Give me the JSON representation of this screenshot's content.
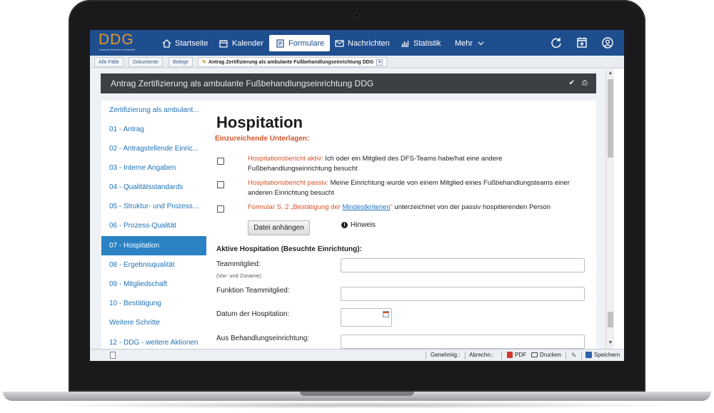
{
  "app": {
    "logo_text": "DDG",
    "logo_subtitle": "Deutsche Diabetes Gesellschaft"
  },
  "nav": {
    "items": [
      {
        "label": "Startseite",
        "icon": "home-icon"
      },
      {
        "label": "Kalender",
        "icon": "calendar-icon"
      },
      {
        "label": "Formulare",
        "icon": "document-icon",
        "active": true
      },
      {
        "label": "Nachrichten",
        "icon": "mail-icon"
      },
      {
        "label": "Statistik",
        "icon": "bar-chart-icon"
      },
      {
        "label": "Mehr",
        "icon": "chevron-down-icon"
      }
    ],
    "right_icons": [
      "refresh-icon",
      "calendar-add-icon",
      "user-icon"
    ]
  },
  "tabs": [
    {
      "label": "Alle Fälle"
    },
    {
      "label": "Dokumente"
    },
    {
      "label": "Belege"
    },
    {
      "label": "Antrag Zertifizierung als ambulante Fußbehandlungseinrichtung DDG",
      "active": true
    }
  ],
  "form_title": "Antrag Zertifizierung als ambulante Fußbehandlungseinrichtung DDG",
  "sidebar": {
    "items": [
      {
        "label": "Zertifizierung als ambulant..."
      },
      {
        "label": "01 - Antrag"
      },
      {
        "label": "02 - Antragstellende Einric..."
      },
      {
        "label": "03 - Interne Angaben"
      },
      {
        "label": "04 - Qualitätsstandards"
      },
      {
        "label": "05 - Struktur- und Prozess..."
      },
      {
        "label": "06 - Prozess-Qualität"
      },
      {
        "label": "07 - Hospitation",
        "active": true
      },
      {
        "label": "08 - Ergebnisqualität"
      },
      {
        "label": "09 - Mitgliedschaft"
      },
      {
        "label": "10 - Bestätigung"
      },
      {
        "label": "Weitere Schritte"
      },
      {
        "label": "12 - DDG - weitere Aktionen"
      }
    ]
  },
  "main": {
    "heading": "Hospitation",
    "subheading": "Einzureichende Unterlagen:",
    "requirements": [
      {
        "highlight": "Hospitationsbericht aktiv:",
        "text": " Ich oder ein Mitglied des DFS-Teams habe/hat eine andere Fußbehandlungseinrichtung besucht"
      },
      {
        "highlight": "Hospitationsbericht passiv:",
        "text": " Meine Einrichtung wurde von einem Mitglied eines Fußbehandlungsteams einer anderen Einrichtung besucht"
      },
      {
        "highlight": "Formular S. 2 „Bestätigung der ",
        "link": "Mindestkriterien",
        "highlight_end": "“",
        "text": " unterzeichnet von der passiv hospitierenden Person"
      }
    ],
    "attach_button": "Datei anhängen",
    "hint": "Hinweis",
    "section_heading": "Aktive Hospitation (Besuchte Einrichtung):",
    "fields": [
      {
        "label": "Teammitglied:",
        "sublabel": "(Vor- und Zuname)",
        "value": ""
      },
      {
        "label": "Funktion Teammitglied:",
        "value": ""
      },
      {
        "label": "Datum der Hospitation:",
        "value": ""
      },
      {
        "label": "Aus Behandlungseinrichtung:",
        "value": ""
      }
    ]
  },
  "statusbar": {
    "genehmig": "Genehmig.:",
    "abrechn": "Abrechn.:",
    "pdf": "PDF",
    "drucken": "Drucken",
    "speichern": "Speichern"
  },
  "colors": {
    "nav_bg": "#1f4e8f",
    "accent_orange": "#d5532a",
    "link_blue": "#1f72b8",
    "active_sidebar": "#2b83c4",
    "titlebar_bg": "#3c3f43"
  }
}
